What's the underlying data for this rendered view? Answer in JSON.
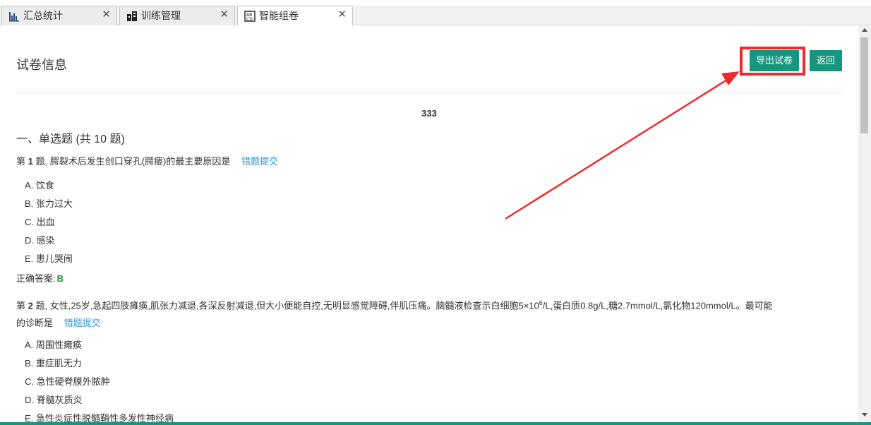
{
  "tabs": [
    {
      "label": "汇总统计",
      "icon": "bar-chart-icon",
      "active": false
    },
    {
      "label": "训练管理",
      "icon": "document-stack-icon",
      "active": false
    },
    {
      "label": "智能组卷",
      "icon": "abc-paper-icon",
      "active": true
    }
  ],
  "tab_close_symbol": "✕",
  "header": {
    "title": "试卷信息",
    "export_label": "导出试卷",
    "back_label": "返回"
  },
  "paper": {
    "name": "333",
    "section_title": "一、单选题 (共 ",
    "section_count": "10",
    "section_suffix": " 题)"
  },
  "questions": [
    {
      "prefix": "第 ",
      "number": "1",
      "after_number": " 题,",
      "stem": "腭裂术后发生创口穿孔(腭瘘)的最主要原因是",
      "report_label": "错题提交",
      "options": [
        "A. 饮食",
        "B. 张力过大",
        "C. 出血",
        "D. 感染",
        "E. 患儿哭闹"
      ],
      "answer_label": "正确答案:",
      "answer_value": "B"
    },
    {
      "prefix": "第 ",
      "number": "2",
      "after_number": " 题,",
      "stem_part1": "女性,25岁,急起四肢瘫痪,肌张力减退,各深反射减退,但大小便能自控,无明显感觉障碍,伴肌压痛。脑髓液检查示白细胞5×10",
      "stem_sup": "6",
      "stem_part2": "/L,蛋白质0.8g/L,糖2.7mmol/L,氯化物120mmol/L。最可能",
      "stem_line2": "的诊断是",
      "report_label": "错题提交",
      "options": [
        "A. 周围性瘫痪",
        "B. 重症肌无力",
        "C. 急性硬脊膜外脓肿",
        "D. 脊髓灰质炎",
        "E. 急性炎症性脱髓鞘性多发性神经病"
      ]
    }
  ],
  "colors": {
    "accent": "#16967f",
    "link": "#2f9bd6",
    "annotation": "#ee2b2b",
    "answer": "#2a8a3a"
  }
}
